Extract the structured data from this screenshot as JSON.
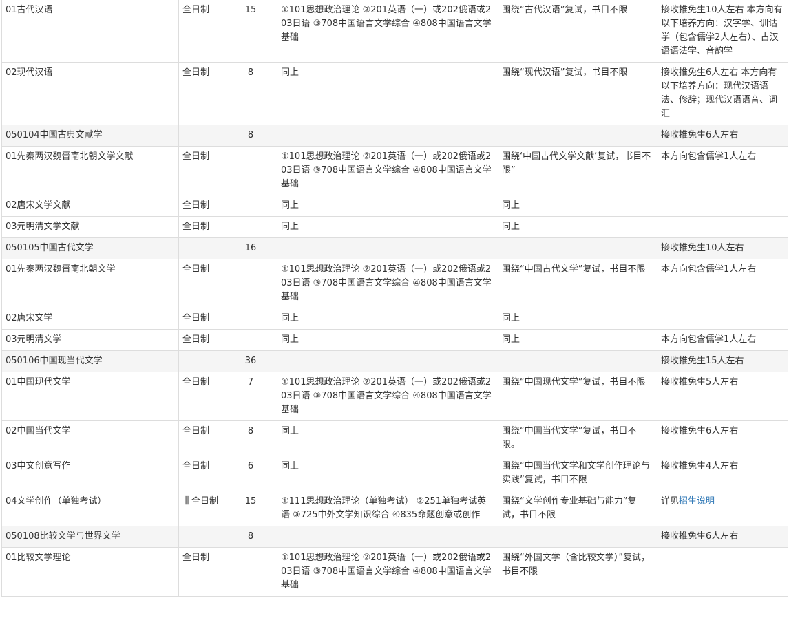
{
  "rows": [
    {
      "type": "sub",
      "name": "01古代汉语",
      "mode": "全日制",
      "quota": "15",
      "subjects": "①101思想政治理论 ②201英语（一）或202俄语或203日语 ③708中国语言文学综合 ④808中国语言文学基础",
      "retest": "围绕“古代汉语”复试，书目不限",
      "note": "接收推免生10人左右 本方向有以下培养方向：汉字学、训诂学（包含儒学2人左右）、古汉语语法学、音韵学"
    },
    {
      "type": "sub",
      "name": "02现代汉语",
      "mode": "全日制",
      "quota": "8",
      "subjects": "同上",
      "retest": "围绕“现代汉语”复试，书目不限",
      "note": "接收推免生6人左右 本方向有以下培养方向：现代汉语语法、修辞；现代汉语语音、词汇"
    },
    {
      "type": "major",
      "name": "050104中国古典文献学",
      "mode": "",
      "quota": "8",
      "subjects": "",
      "retest": "",
      "note": "接收推免生6人左右"
    },
    {
      "type": "sub",
      "name": "01先秦两汉魏晋南北朝文学文献",
      "mode": "全日制",
      "quota": "",
      "subjects": "①101思想政治理论 ②201英语（一）或202俄语或203日语 ③708中国语言文学综合 ④808中国语言文学基础",
      "retest": "围绕‘中国古代文学文献’复试，书目不限”",
      "note": "本方向包含儒学1人左右"
    },
    {
      "type": "sub",
      "name": "02唐宋文学文献",
      "mode": "全日制",
      "quota": "",
      "subjects": "同上",
      "retest": "同上",
      "note": ""
    },
    {
      "type": "sub",
      "name": "03元明清文学文献",
      "mode": "全日制",
      "quota": "",
      "subjects": "同上",
      "retest": "同上",
      "note": ""
    },
    {
      "type": "major",
      "name": "050105中国古代文学",
      "mode": "",
      "quota": "16",
      "subjects": "",
      "retest": "",
      "note": "接收推免生10人左右"
    },
    {
      "type": "sub",
      "name": "01先秦两汉魏晋南北朝文学",
      "mode": "全日制",
      "quota": "",
      "subjects": "①101思想政治理论 ②201英语（一）或202俄语或203日语 ③708中国语言文学综合 ④808中国语言文学基础",
      "retest": "围绕“中国古代文学”复试，书目不限",
      "note": "本方向包含儒学1人左右"
    },
    {
      "type": "sub",
      "name": "02唐宋文学",
      "mode": "全日制",
      "quota": "",
      "subjects": "同上",
      "retest": "同上",
      "note": ""
    },
    {
      "type": "sub",
      "name": "03元明清文学",
      "mode": "全日制",
      "quota": "",
      "subjects": "同上",
      "retest": "同上",
      "note": "本方向包含儒学1人左右"
    },
    {
      "type": "major",
      "name": "050106中国现当代文学",
      "mode": "",
      "quota": "36",
      "subjects": "",
      "retest": "",
      "note": "接收推免生15人左右"
    },
    {
      "type": "sub",
      "name": "01中国现代文学",
      "mode": "全日制",
      "quota": "7",
      "subjects": "①101思想政治理论 ②201英语（一）或202俄语或203日语 ③708中国语言文学综合 ④808中国语言文学基础",
      "retest": "围绕“中国现代文学”复试，书目不限",
      "note": "接收推免生5人左右"
    },
    {
      "type": "sub",
      "name": "02中国当代文学",
      "mode": "全日制",
      "quota": "8",
      "subjects": "同上",
      "retest": "围绕“中国当代文学”复试，书目不限。",
      "note": "接收推免生6人左右"
    },
    {
      "type": "sub",
      "name": "03中文创意写作",
      "mode": "全日制",
      "quota": "6",
      "subjects": "同上",
      "retest": "围绕“中国当代文学和文学创作理论与实践”复试，书目不限",
      "note": "接收推免生4人左右"
    },
    {
      "type": "sub",
      "name": "04文学创作（单独考试）",
      "mode": "非全日制",
      "quota": "15",
      "subjects": "①111思想政治理论（单独考试） ②251单独考试英语 ③725中外文学知识综合 ④835命题创意或创作",
      "retest": "围绕“文学创作专业基础与能力”复试，书目不限",
      "note": "详见",
      "note_link": "招生说明"
    },
    {
      "type": "major",
      "name": "050108比较文学与世界文学",
      "mode": "",
      "quota": "8",
      "subjects": "",
      "retest": "",
      "note": "接收推免生6人左右"
    },
    {
      "type": "sub",
      "name": "01比较文学理论",
      "mode": "全日制",
      "quota": "",
      "subjects": "①101思想政治理论 ②201英语（一）或202俄语或203日语 ③708中国语言文学综合 ④808中国语言文学基础",
      "retest": "围绕“外国文学（含比较文学）”复试，书目不限",
      "note": ""
    }
  ]
}
